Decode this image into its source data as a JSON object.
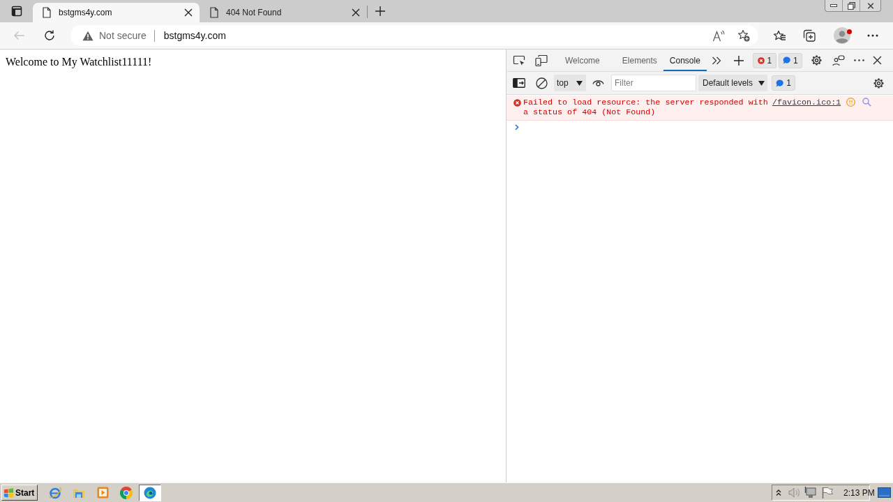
{
  "browser": {
    "tabs": [
      {
        "title": "bstgms4y.com",
        "selected": true
      },
      {
        "title": "404 Not Found",
        "selected": false
      }
    ],
    "toolbar": {
      "back_button": {
        "disabled": true
      },
      "security_label": "Not secure",
      "url": "bstgms4y.com",
      "profile_notification": true
    }
  },
  "page": {
    "heading": "Welcome to My Watchlist11111!"
  },
  "devtools": {
    "tabs": [
      {
        "label": "Welcome",
        "selected": false
      },
      {
        "label": "Elements",
        "selected": false
      },
      {
        "label": "Console",
        "selected": true
      }
    ],
    "error_count": "1",
    "message_count": "1",
    "console_toolbar": {
      "context": "top",
      "filter_placeholder": "Filter",
      "levels": "Default levels",
      "issues_count": "1"
    },
    "messages": [
      {
        "kind": "error",
        "text": "Failed to load resource: the server responded with a status of 404 (Not Found)",
        "source": "/favicon.ico:1"
      }
    ]
  },
  "taskbar": {
    "start": "Start",
    "apps": [
      {
        "kind": "ie",
        "selected": false
      },
      {
        "kind": "folder",
        "selected": false
      },
      {
        "kind": "player",
        "selected": false
      },
      {
        "kind": "chrome",
        "selected": false
      },
      {
        "kind": "edge",
        "selected": true
      }
    ],
    "clock": "2:13 PM"
  }
}
